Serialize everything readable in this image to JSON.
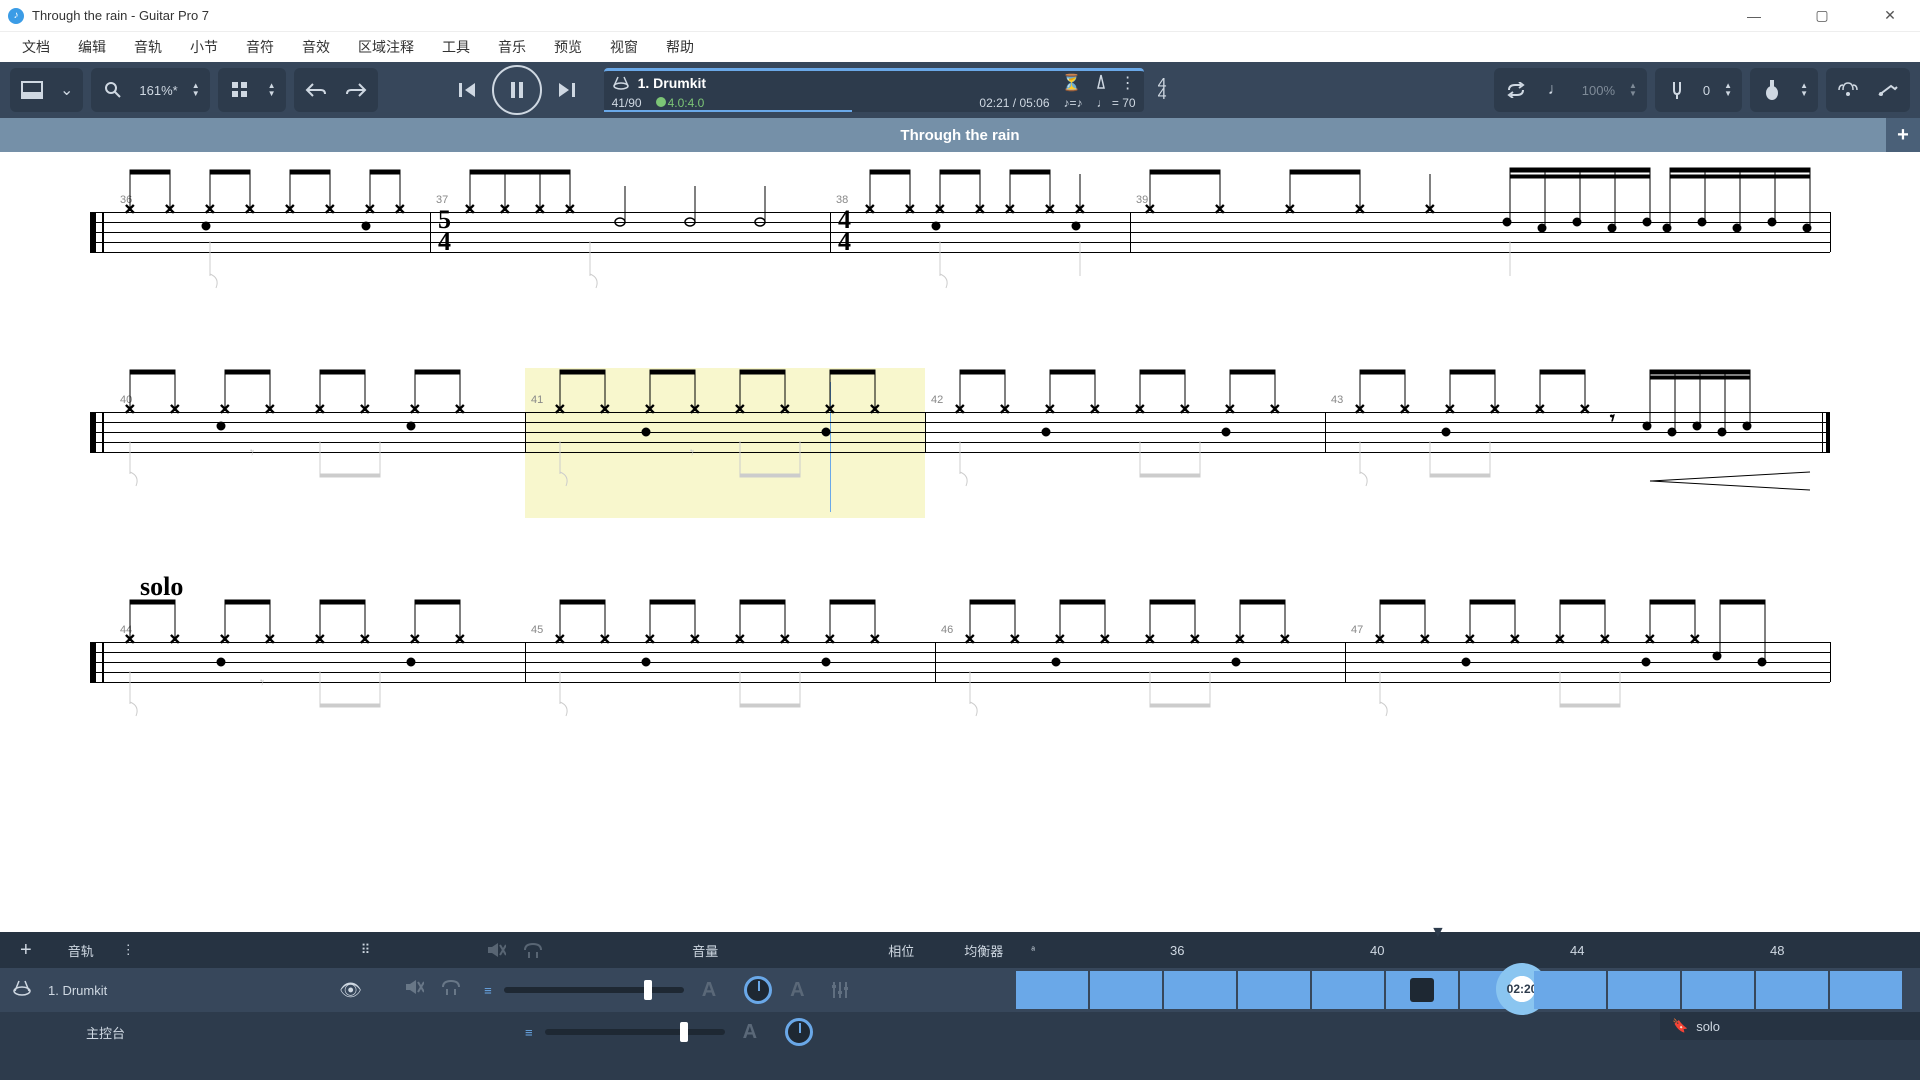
{
  "window": {
    "title": "Through the rain - Guitar Pro 7"
  },
  "menu": [
    "文档",
    "编辑",
    "音轨",
    "小节",
    "音符",
    "音效",
    "区域注释",
    "工具",
    "音乐",
    "预览",
    "视窗",
    "帮助"
  ],
  "toolbar": {
    "zoom": "161%*",
    "track": {
      "number": "1.",
      "name": "Drumkit"
    },
    "bar_position": "41/90",
    "loop_label": "4.0:4.0",
    "time_current": "02:21",
    "time_total": "05:06",
    "tempo": "70",
    "timesig_top": "4",
    "timesig_bot": "4",
    "speed_pct": "100%",
    "tuning": "0"
  },
  "song_title": "Through the rain",
  "score": {
    "row1": {
      "bars": [
        "36",
        "37",
        "38",
        "39"
      ],
      "ts1_top": "5",
      "ts1_bot": "4",
      "ts2_top": "4",
      "ts2_bot": "4"
    },
    "row2": {
      "bars": [
        "40",
        "41",
        "42",
        "43"
      ]
    },
    "row3": {
      "bars": [
        "44",
        "45",
        "46",
        "47"
      ],
      "section": "solo"
    }
  },
  "bottom": {
    "add": "+",
    "header_track": "音轨",
    "header_vol": "音量",
    "header_pan": "相位",
    "header_eq": "均衡器",
    "measure_ticks": [
      "36",
      "40",
      "44",
      "48"
    ],
    "track_num": "1.",
    "track_name": "Drumkit",
    "master": "主控台",
    "time_badge": "02:20",
    "section_name": "solo",
    "eq_sym": "ᵃ"
  }
}
